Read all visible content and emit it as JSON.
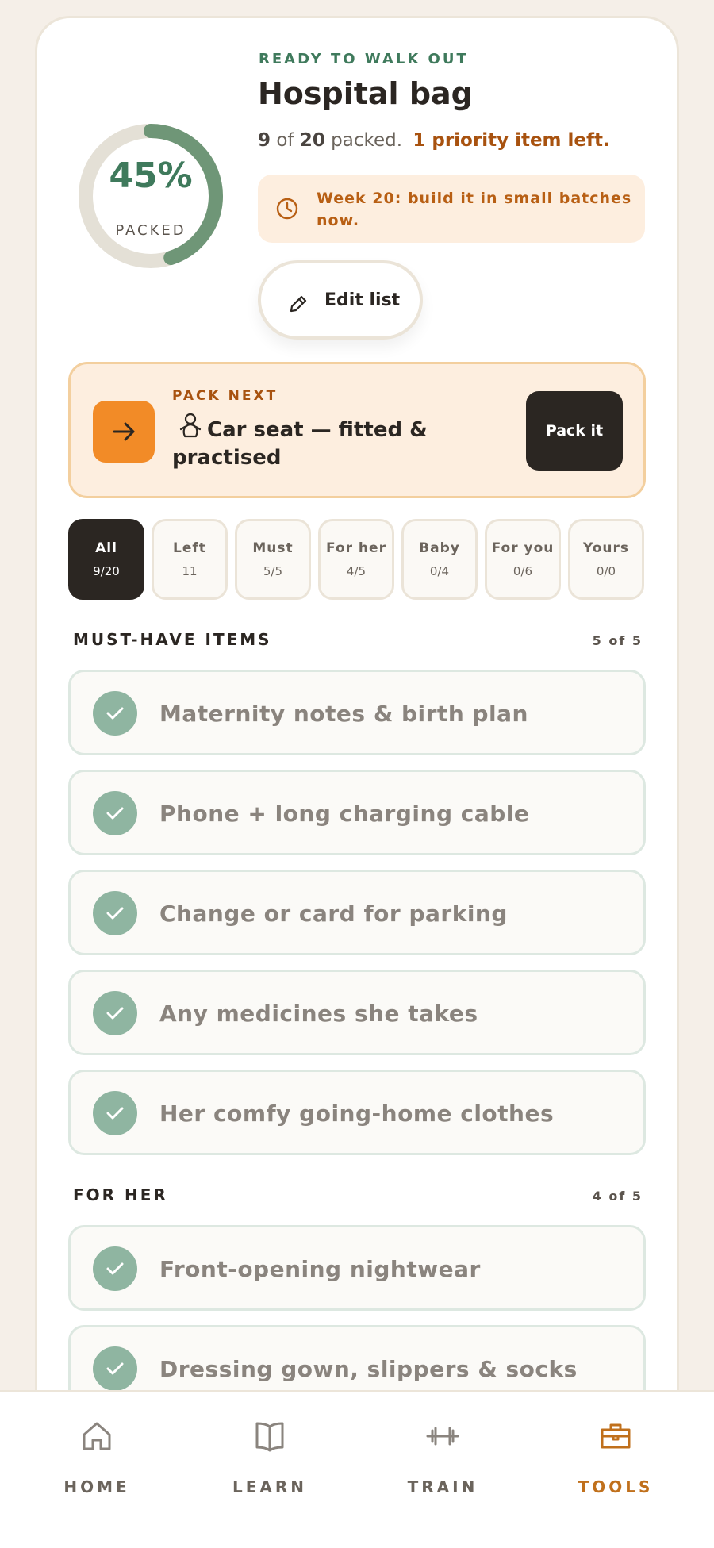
{
  "header": {
    "eyebrow": "READY TO WALK OUT",
    "title": "Hospital bag",
    "packed_count": "9",
    "of_label": "of",
    "total_count": "20",
    "packed_label": "packed.",
    "priority_text": "1 priority item left.",
    "tip": "Week 20: build it in small batches now.",
    "edit_label": "Edit list"
  },
  "progress": {
    "percent_label": "45%",
    "value": 0.45,
    "caption": "PACKED",
    "track_color": "#e4e0d6",
    "fill_color": "#6f9677"
  },
  "pack_next": {
    "eyebrow": "PACK NEXT",
    "item": "Car seat — fitted & practised",
    "button": "Pack it",
    "icon": "baby-icon"
  },
  "filters": [
    {
      "label": "All",
      "count": "9/20",
      "active": true
    },
    {
      "label": "Left",
      "count": "11"
    },
    {
      "label": "Must",
      "count": "5/5"
    },
    {
      "label": "For her",
      "count": "4/5"
    },
    {
      "label": "Baby",
      "count": "0/4"
    },
    {
      "label": "For you",
      "count": "0/6"
    },
    {
      "label": "Yours",
      "count": "0/0"
    }
  ],
  "sections": [
    {
      "title": "MUST-HAVE ITEMS",
      "count": "5 of 5",
      "items": [
        "Maternity notes & birth plan",
        "Phone + long charging cable",
        "Change or card for parking",
        "Any medicines she takes",
        "Her comfy going-home clothes"
      ]
    },
    {
      "title": "FOR HER",
      "count": "4 of 5",
      "items": [
        "Front-opening nightwear",
        "Dressing gown, slippers & socks"
      ]
    }
  ],
  "nav": [
    {
      "label": "HOME",
      "icon": "home-icon"
    },
    {
      "label": "LEARN",
      "icon": "book-icon"
    },
    {
      "label": "TRAIN",
      "icon": "dumbbell-icon"
    },
    {
      "label": "TOOLS",
      "icon": "toolbox-icon",
      "active": true
    }
  ],
  "colors": {
    "accent_green": "#3f7a5c",
    "accent_orange": "#f28b27",
    "priority": "#a8520f",
    "dark": "#2b2622"
  }
}
